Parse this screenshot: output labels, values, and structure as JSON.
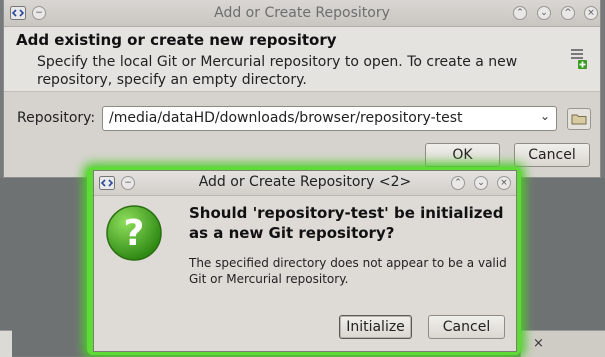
{
  "back_window": {
    "title": "Add or Create Repository",
    "header_title": "Add existing or create new repository",
    "header_desc": "Specify the local Git or Mercurial repository to open. To create a new repository, specify an empty directory.",
    "repo_label": "Repository:",
    "repo_value": "/media/dataHD/downloads/browser/repository-test",
    "ok_label": "OK",
    "cancel_label": "Cancel"
  },
  "dialog": {
    "title": "Add or Create Repository  <2>",
    "question": "Should 'repository-test' be initialized as a new Git repository?",
    "info": "The specified directory does not appear to be a valid Git or Mercurial repository.",
    "initialize_label": "Initialize",
    "cancel_label": "Cancel"
  },
  "colors": {
    "focus_glow": "#5ddc36",
    "question_icon": "#3f9c1f"
  },
  "icons": {
    "app_menu": "app-menu-icon",
    "question": "question-icon",
    "plus": "add-repository-icon",
    "folder": "folder-icon"
  }
}
